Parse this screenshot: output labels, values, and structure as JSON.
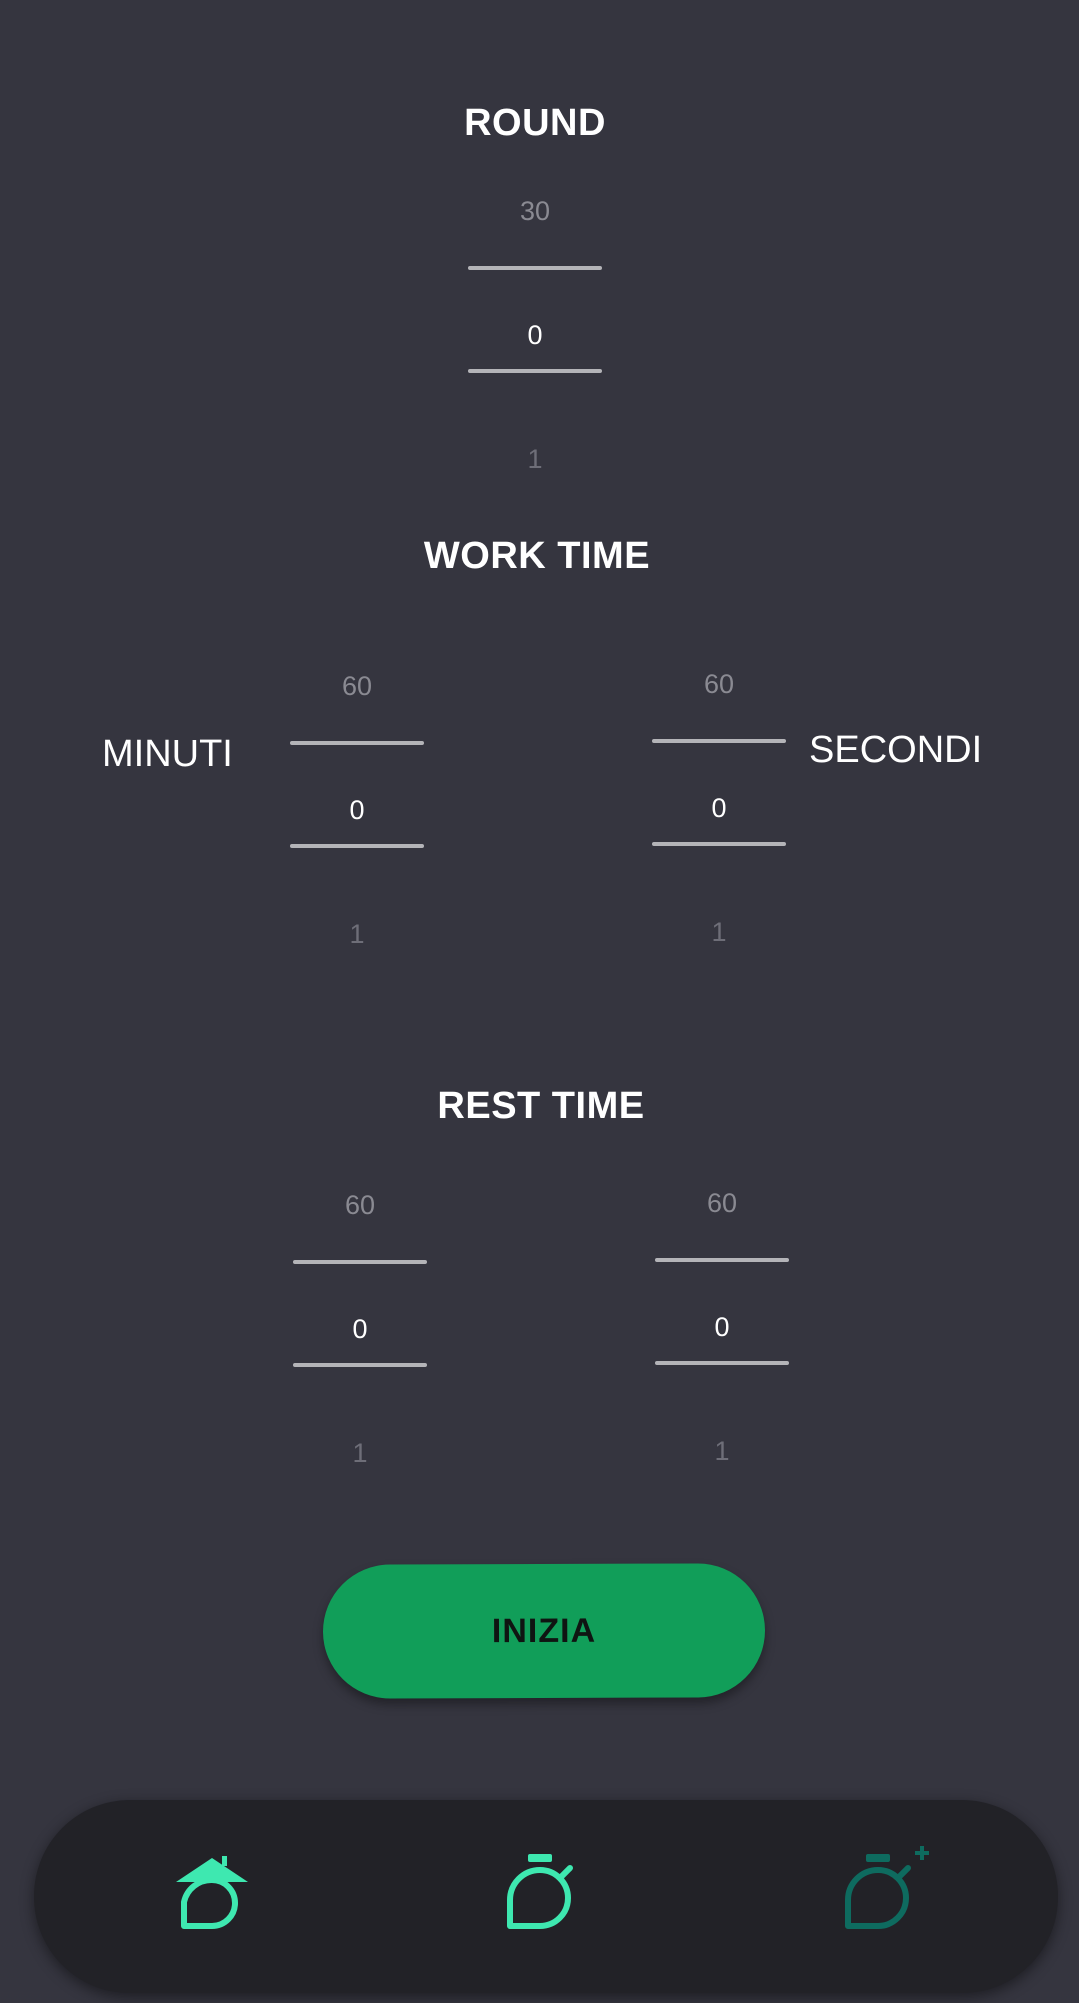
{
  "round": {
    "title": "ROUND",
    "picker": {
      "above": "30",
      "value": "0",
      "below": "1"
    }
  },
  "work_time": {
    "title": "WORK TIME",
    "minutes_label": "MINUTI",
    "seconds_label": "SECONDI",
    "minutes_picker": {
      "above": "60",
      "value": "0",
      "below": "1"
    },
    "seconds_picker": {
      "above": "60",
      "value": "0",
      "below": "1"
    }
  },
  "rest_time": {
    "title": "REST TIME",
    "minutes_picker": {
      "above": "60",
      "value": "0",
      "below": "1"
    },
    "seconds_picker": {
      "above": "60",
      "value": "0",
      "below": "1"
    }
  },
  "start_button": {
    "label": "INIZIA"
  },
  "bottom_nav": {
    "items": [
      {
        "icon": "home-timer-icon",
        "color": "#3ee8b0",
        "active": true
      },
      {
        "icon": "stopwatch-icon",
        "color": "#3ee8b0",
        "active": false
      },
      {
        "icon": "stopwatch-add-icon",
        "color": "#0e6b5f",
        "active": false
      }
    ]
  },
  "colors": {
    "background": "#35353f",
    "accent": "#3ee8b0",
    "button": "#119e59",
    "nav_background": "#222227"
  }
}
